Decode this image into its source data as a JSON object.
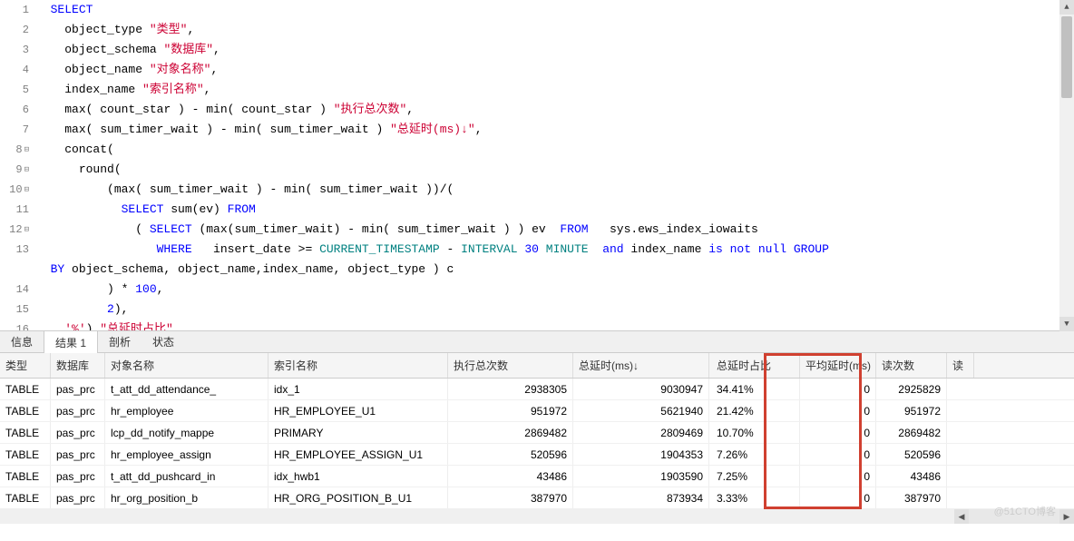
{
  "code": {
    "lines": [
      {
        "n": "1",
        "fold": "",
        "segs": [
          {
            "t": "  ",
            "c": ""
          },
          {
            "t": "SELECT",
            "c": "kw-blue"
          }
        ]
      },
      {
        "n": "2",
        "fold": "",
        "segs": [
          {
            "t": "    object_type ",
            "c": "kw-ident"
          },
          {
            "t": "\"类型\"",
            "c": "kw-red"
          },
          {
            "t": ",",
            "c": ""
          }
        ]
      },
      {
        "n": "3",
        "fold": "",
        "segs": [
          {
            "t": "    object_schema ",
            "c": "kw-ident"
          },
          {
            "t": "\"数据库\"",
            "c": "kw-red"
          },
          {
            "t": ",",
            "c": ""
          }
        ]
      },
      {
        "n": "4",
        "fold": "",
        "segs": [
          {
            "t": "    object_name ",
            "c": "kw-ident"
          },
          {
            "t": "\"对象名称\"",
            "c": "kw-red"
          },
          {
            "t": ",",
            "c": ""
          }
        ]
      },
      {
        "n": "5",
        "fold": "",
        "segs": [
          {
            "t": "    index_name ",
            "c": "kw-ident"
          },
          {
            "t": "\"索引名称\"",
            "c": "kw-red"
          },
          {
            "t": ",",
            "c": ""
          }
        ]
      },
      {
        "n": "6",
        "fold": "",
        "segs": [
          {
            "t": "    ",
            "c": ""
          },
          {
            "t": "max",
            "c": "kw-func"
          },
          {
            "t": "( count_star ) - ",
            "c": ""
          },
          {
            "t": "min",
            "c": "kw-func"
          },
          {
            "t": "( count_star ) ",
            "c": ""
          },
          {
            "t": "\"执行总次数\"",
            "c": "kw-red"
          },
          {
            "t": ",",
            "c": ""
          }
        ]
      },
      {
        "n": "7",
        "fold": "",
        "segs": [
          {
            "t": "    ",
            "c": ""
          },
          {
            "t": "max",
            "c": "kw-func"
          },
          {
            "t": "( sum_timer_wait ) - ",
            "c": ""
          },
          {
            "t": "min",
            "c": "kw-func"
          },
          {
            "t": "( sum_timer_wait ) ",
            "c": ""
          },
          {
            "t": "\"总延时(ms)↓\"",
            "c": "kw-red"
          },
          {
            "t": ",",
            "c": ""
          }
        ]
      },
      {
        "n": "8",
        "fold": "⊟",
        "segs": [
          {
            "t": "    concat(",
            "c": ""
          }
        ]
      },
      {
        "n": "9",
        "fold": "⊟",
        "segs": [
          {
            "t": "      ",
            "c": ""
          },
          {
            "t": "round",
            "c": "kw-func"
          },
          {
            "t": "(",
            "c": ""
          }
        ]
      },
      {
        "n": "10",
        "fold": "⊟",
        "segs": [
          {
            "t": "          (",
            "c": ""
          },
          {
            "t": "max",
            "c": "kw-func"
          },
          {
            "t": "( sum_timer_wait ) - ",
            "c": ""
          },
          {
            "t": "min",
            "c": "kw-func"
          },
          {
            "t": "( sum_timer_wait ))/(",
            "c": ""
          }
        ]
      },
      {
        "n": "11",
        "fold": "",
        "segs": [
          {
            "t": "            ",
            "c": ""
          },
          {
            "t": "SELECT",
            "c": "kw-blue"
          },
          {
            "t": " sum(ev) ",
            "c": ""
          },
          {
            "t": "FROM",
            "c": "kw-blue"
          }
        ]
      },
      {
        "n": "12",
        "fold": "⊟",
        "segs": [
          {
            "t": "              ( ",
            "c": ""
          },
          {
            "t": "SELECT",
            "c": "kw-blue"
          },
          {
            "t": " (",
            "c": ""
          },
          {
            "t": "max",
            "c": "kw-func"
          },
          {
            "t": "(sum_timer_wait) - ",
            "c": ""
          },
          {
            "t": "min",
            "c": "kw-func"
          },
          {
            "t": "( sum_timer_wait ) ) ev  ",
            "c": ""
          },
          {
            "t": "FROM",
            "c": "kw-blue"
          },
          {
            "t": "   sys.ews_index_iowaits",
            "c": ""
          }
        ]
      },
      {
        "n": "13",
        "fold": "",
        "segs": [
          {
            "t": "                 ",
            "c": ""
          },
          {
            "t": "WHERE",
            "c": "kw-blue"
          },
          {
            "t": "   insert_date >= ",
            "c": ""
          },
          {
            "t": "CURRENT_TIMESTAMP",
            "c": "kw-teal"
          },
          {
            "t": " - ",
            "c": ""
          },
          {
            "t": "INTERVAL",
            "c": "kw-teal"
          },
          {
            "t": " ",
            "c": ""
          },
          {
            "t": "30",
            "c": "kw-num"
          },
          {
            "t": " ",
            "c": ""
          },
          {
            "t": "MINUTE",
            "c": "kw-teal"
          },
          {
            "t": "  ",
            "c": ""
          },
          {
            "t": "and",
            "c": "kw-blue"
          },
          {
            "t": " index_name ",
            "c": ""
          },
          {
            "t": "is not null",
            "c": "kw-blue"
          },
          {
            "t": " ",
            "c": ""
          },
          {
            "t": "GROUP",
            "c": "kw-blue"
          }
        ]
      },
      {
        "n": "",
        "fold": "",
        "segs": [
          {
            "t": "  ",
            "c": ""
          },
          {
            "t": "BY",
            "c": "kw-blue"
          },
          {
            "t": " object_schema, object_name,index_name, object_type ) c",
            "c": ""
          }
        ]
      },
      {
        "n": "14",
        "fold": "",
        "segs": [
          {
            "t": "          ) * ",
            "c": ""
          },
          {
            "t": "100",
            "c": "kw-num"
          },
          {
            "t": ",",
            "c": ""
          }
        ]
      },
      {
        "n": "15",
        "fold": "",
        "segs": [
          {
            "t": "          ",
            "c": ""
          },
          {
            "t": "2",
            "c": "kw-num"
          },
          {
            "t": "),",
            "c": ""
          }
        ]
      },
      {
        "n": "16",
        "fold": "",
        "segs": [
          {
            "t": "    ",
            "c": ""
          },
          {
            "t": "'%'",
            "c": "kw-red"
          },
          {
            "t": ") ",
            "c": ""
          },
          {
            "t": "\"总延时占比\"",
            "c": "kw-red"
          },
          {
            "t": ",",
            "c": ""
          }
        ]
      }
    ]
  },
  "tabs": {
    "items": [
      "信息",
      "结果 1",
      "剖析",
      "状态"
    ],
    "active": 1
  },
  "grid": {
    "headers": [
      "类型",
      "数据库",
      "对象名称",
      "索引名称",
      "执行总次数",
      "总延时(ms)↓",
      "总延时占比",
      "平均延时(ms)",
      "读次数",
      "读"
    ],
    "rows": [
      {
        "type": "TABLE",
        "schema": "pas_prc",
        "obj": "t_att_dd_attendance_",
        "idx": "idx_1",
        "exec": "2938305",
        "delay": "9030947",
        "pct": "34.41%",
        "avg": "0",
        "reads": "2925829"
      },
      {
        "type": "TABLE",
        "schema": "pas_prc",
        "obj": "hr_employee",
        "idx": "HR_EMPLOYEE_U1",
        "exec": "951972",
        "delay": "5621940",
        "pct": "21.42%",
        "avg": "0",
        "reads": "951972"
      },
      {
        "type": "TABLE",
        "schema": "pas_prc",
        "obj": "lcp_dd_notify_mappe",
        "idx": "PRIMARY",
        "exec": "2869482",
        "delay": "2809469",
        "pct": "10.70%",
        "avg": "0",
        "reads": "2869482"
      },
      {
        "type": "TABLE",
        "schema": "pas_prc",
        "obj": "hr_employee_assign",
        "idx": "HR_EMPLOYEE_ASSIGN_U1",
        "exec": "520596",
        "delay": "1904353",
        "pct": "7.26%",
        "avg": "0",
        "reads": "520596"
      },
      {
        "type": "TABLE",
        "schema": "pas_prc",
        "obj": "t_att_dd_pushcard_in",
        "idx": "idx_hwb1",
        "exec": "43486",
        "delay": "1903590",
        "pct": "7.25%",
        "avg": "0",
        "reads": "43486"
      },
      {
        "type": "TABLE",
        "schema": "pas_prc",
        "obj": "hr_org_position_b",
        "idx": "HR_ORG_POSITION_B_U1",
        "exec": "387970",
        "delay": "873934",
        "pct": "3.33%",
        "avg": "0",
        "reads": "387970"
      }
    ]
  },
  "watermark": "@51CTO博客"
}
